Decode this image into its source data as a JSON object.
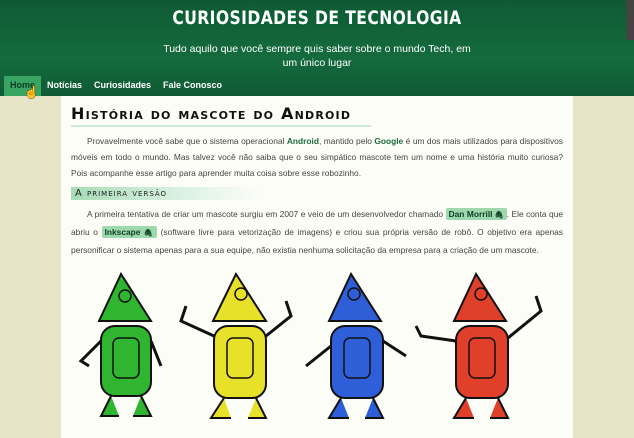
{
  "header": {
    "title": "CURIOSIDADES DE TECNOLOGIA",
    "subtitle": "Tudo aquilo que você sempre quis saber sobre o mundo Tech, em um único lugar"
  },
  "nav": {
    "items": [
      {
        "label": "Home"
      },
      {
        "label": "Notícias"
      },
      {
        "label": "Curiosidades"
      },
      {
        "label": "Fale Conosco"
      }
    ]
  },
  "article": {
    "title": "História do mascote do Android",
    "intro": {
      "p1": "Provavelmente você sabe que o sistema operacional ",
      "android": "Android",
      "p2": ", mantido pelo ",
      "google": "Google",
      "p3": " é um dos mais utilizados para dispositivos móveis em todo o mundo. Mas talvez você não saiba que o seu simpático mascote tem um nome e uma história muito curiosa? Pois acompanhe esse artigo para aprender muita coisa sobre esse robozinho."
    },
    "section1": {
      "title": "A primeira versão",
      "p1": "A primeira tentativa de criar um mascote surgiu em 2007 e veio de um desenvolvedor chamado ",
      "person": "Dan Morrill",
      "p2": ". Ele conta que abriu o ",
      "tool": "Inkscape",
      "p3": " (software livre para vetorização de imagens) e criou sua própria versão de robô. O objetivo era apenas personificar o sistema apenas para a sua equipe, não existia nenhuma solicitação da empresa para a criação de um mascote."
    }
  },
  "robots": {
    "colors": [
      "#2fb52f",
      "#e8e12a",
      "#2f5fd8",
      "#e0402a"
    ]
  }
}
